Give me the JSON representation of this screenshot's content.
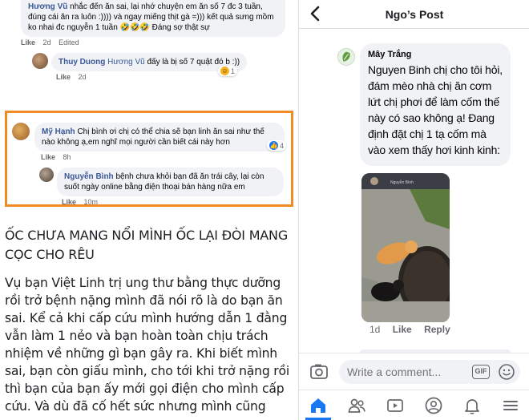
{
  "left_panel": {
    "comment1": {
      "name": "Hương Vũ",
      "text_prefix": "nhắc đến ăn sai, lại nhớ chuyện em ăn số 7 đc 3 tuần, đúng cái ăn ra luôn :)))) và ngay miếng thịt gà =))) kết quả sưng mồm ko nhai đc nguyễn 1 tuần 🤣🤣🤣 Đáng sợ thật sự",
      "meta": [
        "Like",
        "2d",
        "Edited"
      ]
    },
    "comment2": {
      "name": "Thuy Duong",
      "tag": "Hương Vũ",
      "text": "đấy là bị số 7 quật đó b :))",
      "meta": [
        "Like",
        "2d"
      ],
      "reaction_count": "1"
    },
    "comment3": {
      "name": "Mỹ Hạnh",
      "text": "Chị bình ơi chị có thể chia sẽ bạn linh ăn sai như thế nào không ạ,em nghĩ mọi người cần biết cái này hơn",
      "meta": [
        "Like",
        "8h"
      ],
      "reaction_count": "4"
    },
    "comment4": {
      "name": "Nguyễn Bình",
      "text": "bệnh chưa khỏi bạn đã ăn trái cây, lại còn suốt ngày online bằng điện thoại bán hàng nữa em",
      "meta": [
        "Like",
        "10m"
      ]
    },
    "headline": "ỐC CHƯA MANG NỔI MÌNH ỐC LẠI ĐÒI MANG CỌC CHO RÊU",
    "body": "Vụ bạn Việt Linh trị ung thư bằng thực dưỡng rồi trở bệnh nặng mình đã nói rõ là do bạn ăn sai. Kể cả khi cấp cứu mình hướng dẫn 1 đằng vẫn làm 1 nẻo và bạn hoàn toàn chịu trách nhiệm về những gì bạn gây ra. Khi biết mình sai, bạn còn giấu mình, cho tới khi trở nặng rồi thì bạn của bạn ấy mới gọi điện cho mình cấp cứu. Và dù đã cố hết sức nhưng mình cũng"
  },
  "right_panel": {
    "title": "Ngo’s Post",
    "post": {
      "name": "Mây Trắng",
      "text": "Nguyen Binh chị cho tôi hỏi, đám mèo nhà chị ăn cơm lứt chị phơi để làm cốm thế này có sao không ạ! Đang định đặt chị 1 tạ cốm mà vào xem thấy hơi kinh kinh:",
      "photo_caption": "Nguyễn Bình",
      "meta": [
        "1d",
        "Like",
        "Reply"
      ]
    },
    "composer": {
      "placeholder": "Write a comment...",
      "gif_label": "GIF"
    },
    "tabs": [
      "home",
      "friends",
      "watch",
      "profile",
      "notifications",
      "menu"
    ]
  },
  "colors": {
    "accent": "#1877f2",
    "link": "#385898",
    "highlight_border": "#f08a24"
  }
}
